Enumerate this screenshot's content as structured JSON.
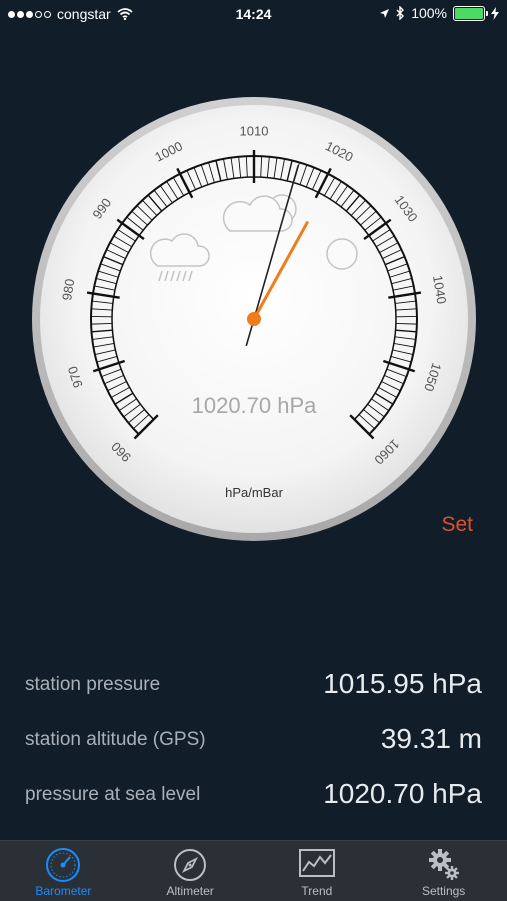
{
  "status_bar": {
    "carrier": "congstar",
    "time": "14:24",
    "battery": "100%"
  },
  "gauge": {
    "tick_labels": [
      "960",
      "970",
      "980",
      "990",
      "1000",
      "1010",
      "1020",
      "1030",
      "1040",
      "1050",
      "1060"
    ],
    "readout": "1020.70 hPa",
    "unit": "hPa/mBar",
    "needle_value_hpa": 1020.7,
    "reference_value_hpa": 1015.95,
    "scale_min_hpa": 960,
    "scale_max_hpa": 1060,
    "needle_color": "#f07d1a",
    "weather_icons": [
      "rain-cloud-icon",
      "cloud-icon",
      "sun-icon"
    ]
  },
  "set_label": "Set",
  "readings": [
    {
      "label": "station pressure",
      "value": "1015.95 hPa"
    },
    {
      "label": "station altitude (GPS)",
      "value": "39.31 m"
    },
    {
      "label": "pressure at sea level",
      "value": "1020.70 hPa"
    }
  ],
  "tabs": [
    {
      "label": "Barometer",
      "icon": "gauge-icon",
      "active": true
    },
    {
      "label": "Altimeter",
      "icon": "compass-icon",
      "active": false
    },
    {
      "label": "Trend",
      "icon": "trend-chart-icon",
      "active": false
    },
    {
      "label": "Settings",
      "icon": "gears-icon",
      "active": false
    }
  ],
  "colors": {
    "background": "#111d29",
    "accent_blue": "#1a8cff",
    "set_orange": "#d9522b",
    "battery_green": "#4cd964"
  }
}
